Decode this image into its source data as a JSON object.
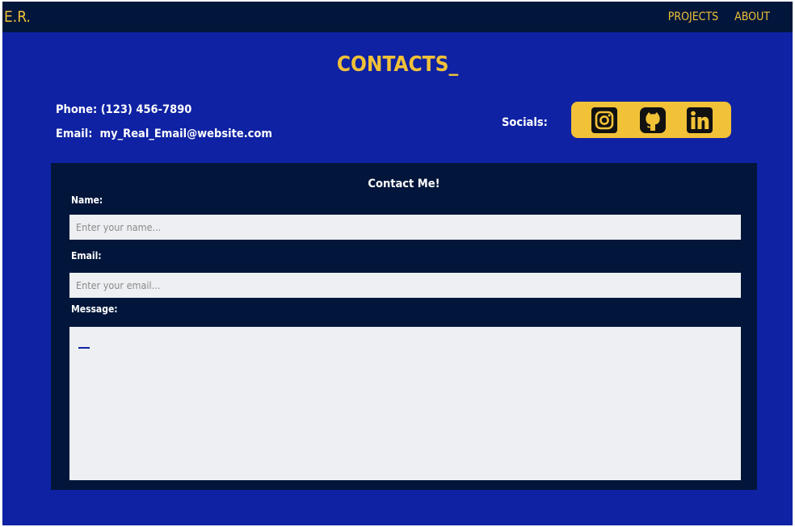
{
  "nav": {
    "brand": "E.R.",
    "links": [
      "PROJECTS",
      "ABOUT"
    ]
  },
  "page_title": "CONTACTS_",
  "contact_info": {
    "phone": "Phone: (123) 456-7890",
    "email": "Email:  my_Real_Email@website.com"
  },
  "socials": {
    "label": "Socials:",
    "icons": [
      "instagram-icon",
      "github-icon",
      "linkedin-icon"
    ]
  },
  "form": {
    "title": "Contact Me!",
    "name_label": "Name:",
    "name_placeholder": "Enter your name...",
    "email_label": "Email:",
    "email_placeholder": "Enter your email...",
    "message_label": "Message:",
    "message_value": ""
  },
  "colors": {
    "background": "#0f22a3",
    "navbar": "#01163a",
    "panel": "#01163a",
    "accent": "#f1c138",
    "input": "#edeff2",
    "text": "#ffffff"
  }
}
